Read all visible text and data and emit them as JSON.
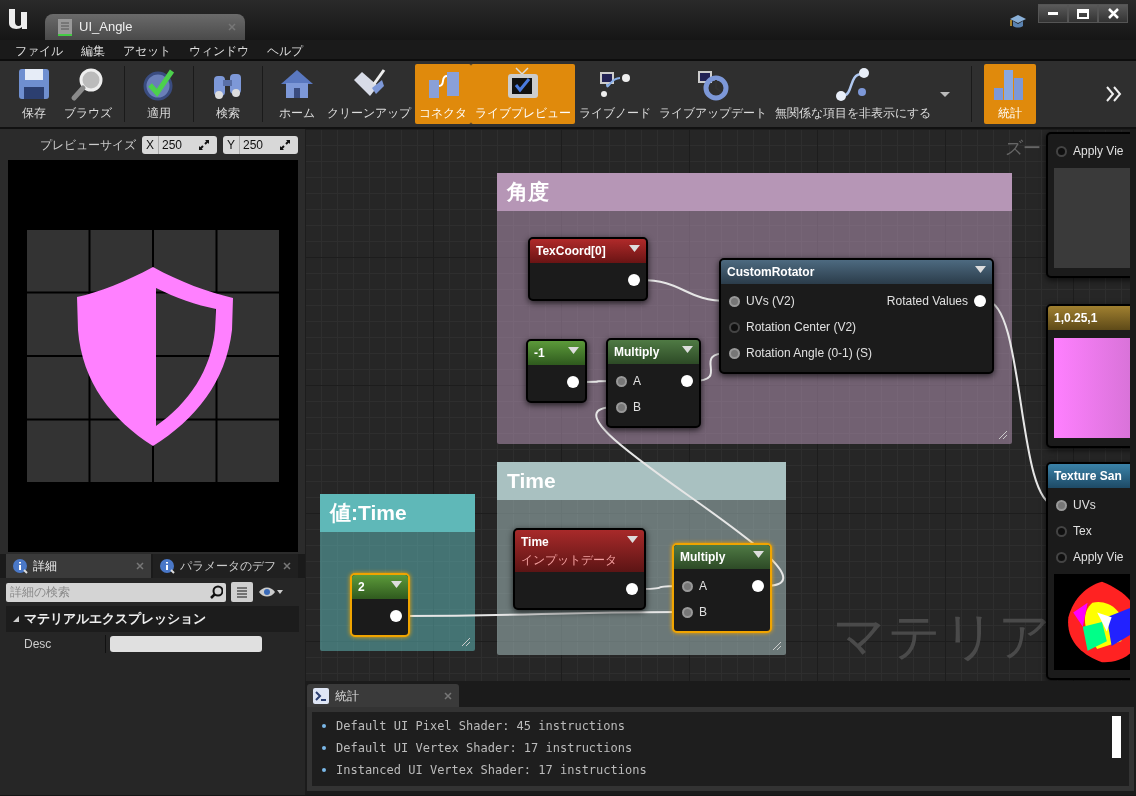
{
  "window": {
    "tab_title": "UI_Angle"
  },
  "menu": [
    "ファイル",
    "編集",
    "アセット",
    "ウィンドウ",
    "ヘルプ"
  ],
  "toolbar": [
    {
      "label": "保存",
      "active": false
    },
    {
      "label": "ブラウズ",
      "active": false
    },
    {
      "label": "適用",
      "active": false
    },
    {
      "label": "検索",
      "active": false
    },
    {
      "label": "ホーム",
      "active": false
    },
    {
      "label": "クリーンアップ",
      "active": false
    },
    {
      "label": "コネクタ",
      "active": true
    },
    {
      "label": "ライブプレビュー",
      "active": true
    },
    {
      "label": "ライブノード",
      "active": false
    },
    {
      "label": "ライブアップデート",
      "active": false
    },
    {
      "label": "無関係な項目を非表示にする",
      "active": false
    },
    {
      "label": "統計",
      "active": true
    }
  ],
  "preview": {
    "label": "プレビューサイズ",
    "x_label": "X",
    "x_value": "250",
    "y_label": "Y",
    "y_value": "250"
  },
  "details": {
    "tabs": [
      {
        "label": "詳細",
        "selected": true
      },
      {
        "label": "パラメータのデフ",
        "selected": false
      }
    ],
    "search_placeholder": "詳細の検索",
    "category": "マテリアルエクスプレッション",
    "rows": [
      {
        "label": "Desc"
      }
    ]
  },
  "graph": {
    "zoom_label": "ズー",
    "watermark": "マテリア",
    "comments": [
      {
        "title": "角度",
        "color": "#b696b6"
      },
      {
        "title": "Time",
        "color": "#a9c1c1"
      },
      {
        "title": "値:Time",
        "color": "#5fb8b8"
      }
    ],
    "nodes": [
      {
        "title": "TexCoord[0]",
        "kind": "coordinate",
        "selected": false,
        "output": true
      },
      {
        "title": "-1",
        "kind": "constant",
        "selected": false,
        "output": true
      },
      {
        "title": "Multiply",
        "kind": "math",
        "selected": false,
        "inputs": [
          {
            "label": "A",
            "connected": true
          },
          {
            "label": "B",
            "connected": true
          }
        ],
        "output": true
      },
      {
        "title": "CustomRotator",
        "kind": "custom",
        "selected": false,
        "inputs": [
          {
            "label": "UVs (V2)",
            "connected": true
          },
          {
            "label": "Rotation Center (V2)",
            "connected": false
          },
          {
            "label": "Rotation Angle (0-1) (S)",
            "connected": true
          }
        ],
        "output": true,
        "output_label": "Rotated Values"
      },
      {
        "title": "2",
        "kind": "constant",
        "selected": true,
        "output": true
      },
      {
        "title": "Time",
        "subtitle": "インプットデータ",
        "kind": "input",
        "selected": false,
        "output": true
      },
      {
        "title": "Multiply",
        "kind": "math",
        "selected": true,
        "inputs": [
          {
            "label": "A",
            "connected": true
          },
          {
            "label": "B",
            "connected": true
          }
        ],
        "output": true
      },
      {
        "kind": "partial",
        "selected": false,
        "inputs": [
          {
            "label": "Apply Vie",
            "connected": false
          }
        ],
        "preview": true
      },
      {
        "title": "1,0.25,1",
        "kind": "vector",
        "selected": false,
        "preview": true
      },
      {
        "title": "Texture San",
        "kind": "texture",
        "selected": false,
        "inputs": [
          {
            "label": "UVs",
            "connected": true
          },
          {
            "label": "Tex",
            "connected": false
          },
          {
            "label": "Apply Vie",
            "connected": false
          }
        ],
        "preview": true
      }
    ]
  },
  "stats": {
    "tab": "統計",
    "lines": [
      "Default UI Pixel Shader: 45 instructions",
      "Default UI Vertex Shader: 17 instructions",
      "Instanced UI Vertex Shader: 17 instructions"
    ]
  }
}
